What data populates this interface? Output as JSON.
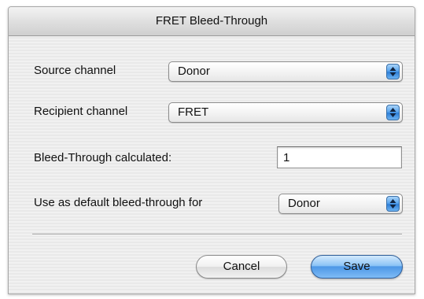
{
  "window": {
    "title": "FRET Bleed-Through"
  },
  "form": {
    "source_channel_label": "Source channel",
    "source_channel_value": "Donor",
    "recipient_channel_label": "Recipient channel",
    "recipient_channel_value": "FRET",
    "bleed_through_label": "Bleed-Through calculated:",
    "bleed_through_value": "1",
    "default_label": "Use as default bleed-through for",
    "default_value": "Donor"
  },
  "buttons": {
    "cancel_label": "Cancel",
    "save_label": "Save"
  },
  "icons": {
    "popup_arrows": "updown-arrows-icon"
  },
  "colors": {
    "accent": "#4d97e6"
  }
}
